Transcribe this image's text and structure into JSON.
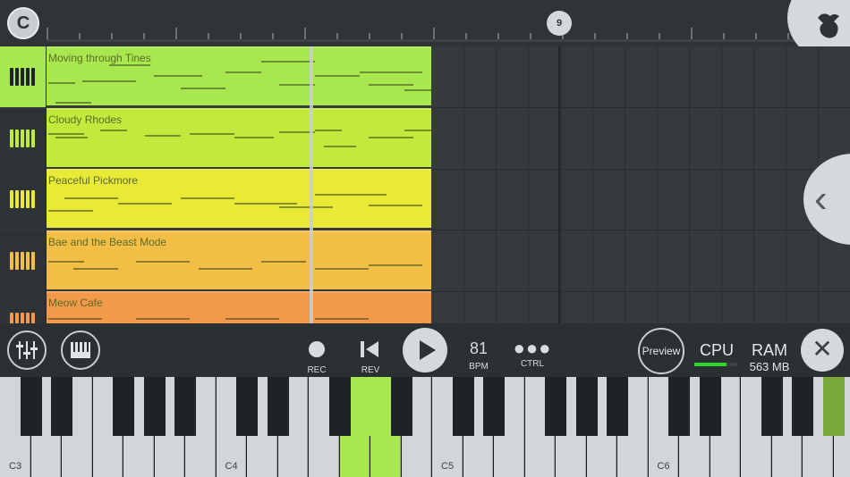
{
  "app": {
    "logo_letter": "C",
    "timeline_marker": "9"
  },
  "tracks": [
    {
      "name": "Moving through Tines",
      "color": "#a8e84e",
      "selected": true
    },
    {
      "name": "Cloudy Rhodes",
      "color": "#c2ea3c"
    },
    {
      "name": "Peaceful Pickmore",
      "color": "#e9ea38"
    },
    {
      "name": "Bae and the Beast Mode",
      "color": "#f2be45"
    },
    {
      "name": "Meow Cafe",
      "color": "#f39a4a"
    }
  ],
  "controls": {
    "rec_label": "REC",
    "rev_label": "REV",
    "bpm_value": "81",
    "bpm_label": "BPM",
    "ctrl_label": "CTRL",
    "preview_label": "Preview",
    "cpu_label": "CPU",
    "cpu_level": 0.75,
    "ram_label": "RAM",
    "ram_value": "563 MB",
    "close_symbol": "✕"
  },
  "keyboard": {
    "octave_labels": [
      "C3",
      "C4",
      "C5",
      "C6"
    ]
  },
  "colors": {
    "accent_green": "#a8e84e",
    "cpu_green": "#34d52a"
  }
}
